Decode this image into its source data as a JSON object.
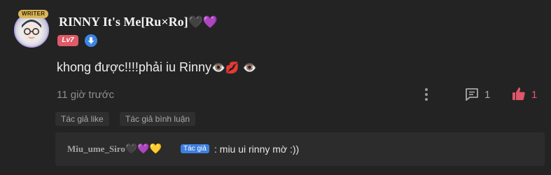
{
  "comment": {
    "author": {
      "avatar_badge": "WRITER",
      "name": "RINNY It's Me[Ru×Ro]",
      "name_hearts": "🖤💜",
      "level": "Lv7"
    },
    "text": "khong được!!!!phải iu Rinny",
    "text_emojis": "👁️💋 👁️",
    "timestamp": "11 giờ trước",
    "reply_count": "1",
    "like_count": "1",
    "tags": {
      "author_liked": "Tác giả like",
      "author_replied": "Tác giả bình luận"
    },
    "reply": {
      "author": "Miu_ume_Siro",
      "author_hearts": "🖤💜💛",
      "author_tag": "Tác giả",
      "text": ": miu ui rinny mờ :))"
    }
  },
  "icons": {
    "more": "more-vertical-icon",
    "reply": "comment-bubble-icon",
    "like": "thumbs-up-icon",
    "verify": "microphone-badge-icon"
  },
  "colors": {
    "background": "#232323",
    "reply_background": "#2c2c2c",
    "like_accent": "#e0566a",
    "level_badge": "#e05a68",
    "author_tag": "#3d7fe0",
    "muted_text": "#8e8e8e"
  }
}
